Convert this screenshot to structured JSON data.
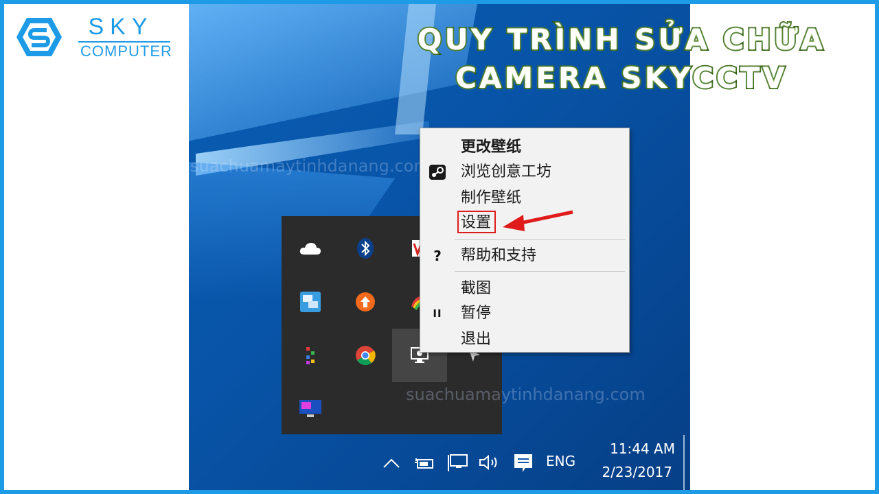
{
  "brand": {
    "name": "SKY",
    "subtitle": "COMPUTER"
  },
  "headline": {
    "line1": "QUY TRÌNH SỬA CHỮA",
    "line2": "CAMERA SKYCCTV"
  },
  "watermark": "suachuamaytinhdanang.com",
  "context_menu": {
    "items": [
      {
        "label": "更改壁纸",
        "bold": true,
        "icon": ""
      },
      {
        "label": "浏览创意工坊",
        "icon": "steam-icon"
      },
      {
        "label": "制作壁纸",
        "icon": ""
      },
      {
        "label": "设置",
        "icon": "",
        "highlighted": true
      },
      {
        "label": "帮助和支持",
        "icon": "question-icon",
        "icon_glyph": "?"
      },
      {
        "label": "截图",
        "icon": ""
      },
      {
        "label": "暂停",
        "icon": "pause-icon",
        "icon_glyph": "II"
      },
      {
        "label": "退出",
        "icon": ""
      }
    ]
  },
  "tray_icons": [
    "onedrive-cloud-icon",
    "bluetooth-icon",
    "wps-office-icon",
    "network-manager-icon",
    "upload-arrow-icon",
    "rainbow-app-icon",
    "color-dots-icon",
    "chrome-icon",
    "wallpaper-engine-icon",
    "arrow-app-icon",
    "monitor-fps-icon"
  ],
  "taskbar": {
    "language": "ENG",
    "time": "11:44 AM",
    "date": "2/23/2017",
    "icons": [
      "chevron-up-icon",
      "battery-icon",
      "network-icon",
      "volume-icon",
      "notification-icon"
    ]
  },
  "colors": {
    "accent": "#1e9be6",
    "arrow": "#e01b1b",
    "menu_bg": "#f2f2f2",
    "tray_bg": "#2b2b2b"
  }
}
